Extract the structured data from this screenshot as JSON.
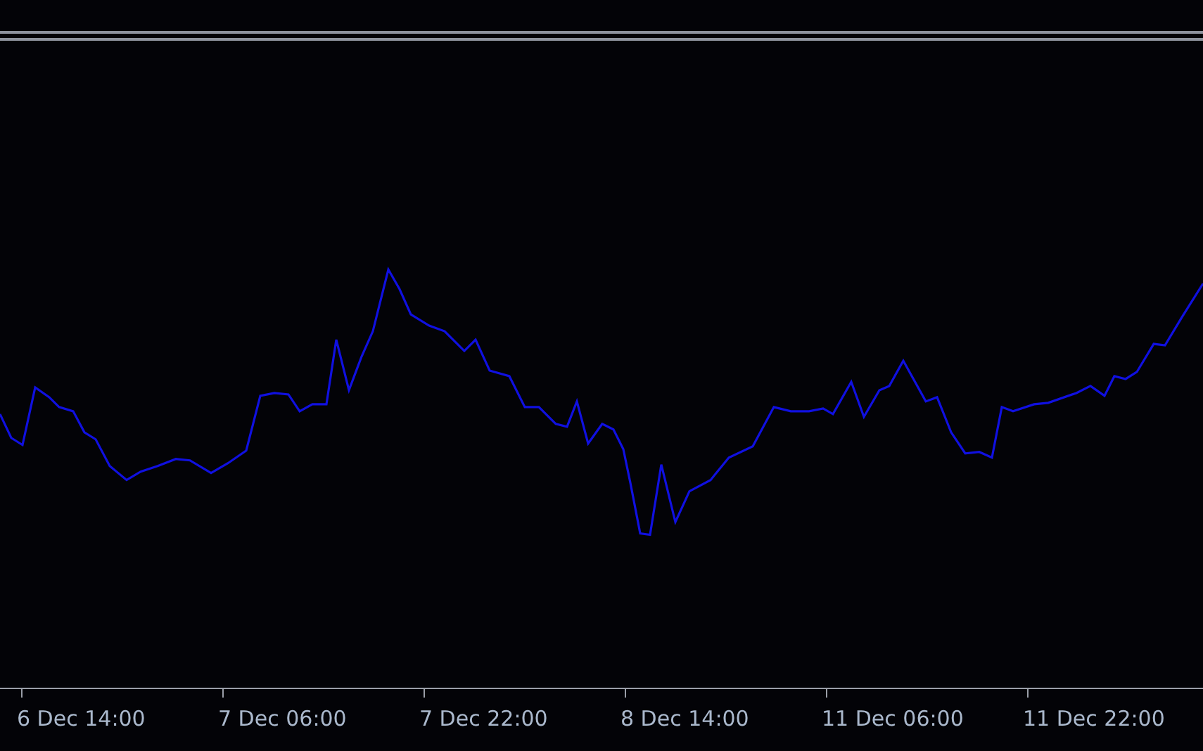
{
  "time_axis": {
    "labels": [
      "6 Dec 14:00",
      "7 Dec 06:00",
      "7 Dec 22:00",
      "8 Dec 14:00",
      "11 Dec 06:00",
      "11 Dec 22:00"
    ]
  }
}
